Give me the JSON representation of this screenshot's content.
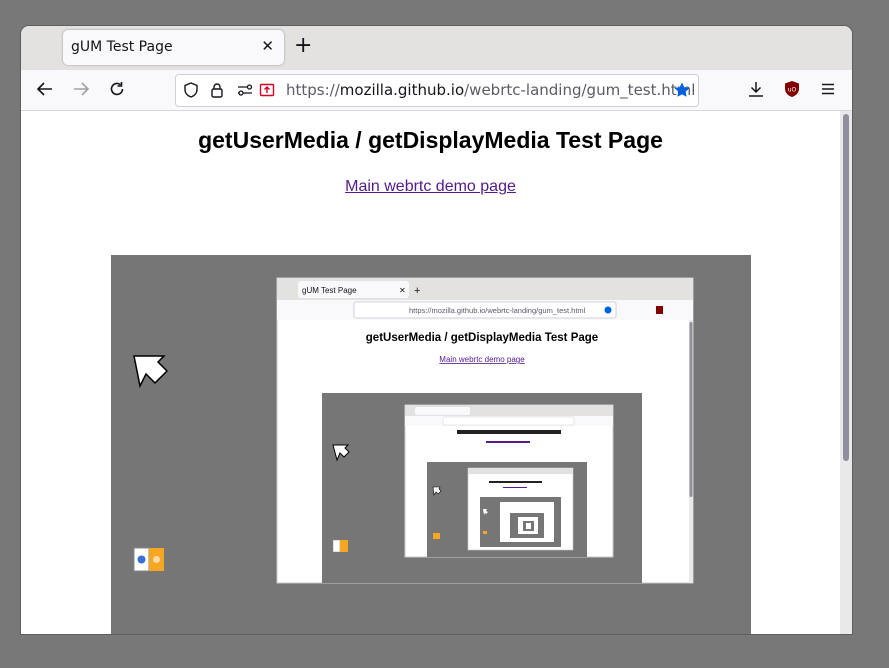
{
  "browser": {
    "tab": {
      "title": "gUM Test Page",
      "close_icon": "close-icon"
    },
    "new_tab_label": "+",
    "url": {
      "protocol": "https://",
      "domain": "mozilla.github.io",
      "path": "/webrtc-landing/gum_test.html"
    }
  },
  "page": {
    "title": "getUserMedia / getDisplayMedia Test Page",
    "link": "Main webrtc demo page"
  },
  "video": {
    "description": "screen share preview (recursive)",
    "inner_tab_title": "gUM Test Page",
    "inner_url": "https://mozilla.github.io/webrtc-landing/gum_test.html",
    "inner_title": "getUserMedia / getDisplayMedia Test Page",
    "inner_link": "Main webrtc demo page"
  },
  "colors": {
    "link": "#551a8b",
    "accent": "#0060df",
    "video_bg": "#767676",
    "ublock": "#800000"
  }
}
